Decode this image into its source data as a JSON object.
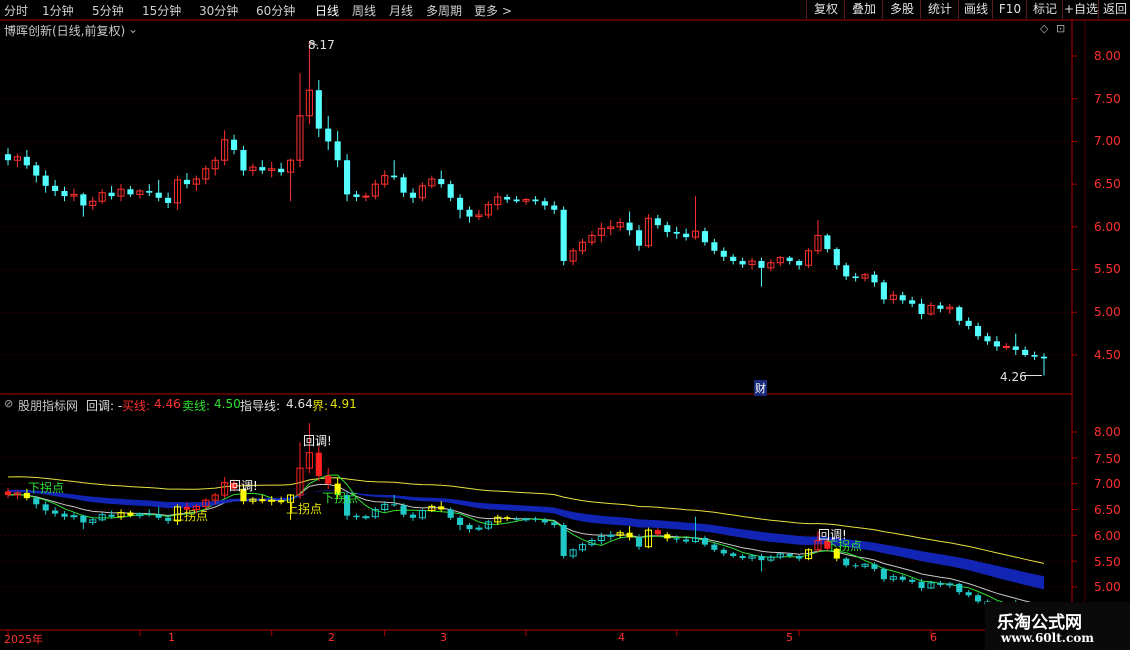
{
  "toolbar": {
    "periods": [
      "分时",
      "1分钟",
      "5分钟",
      "15分钟",
      "30分钟",
      "60分钟",
      "日线",
      "周线",
      "月线",
      "多周期",
      "更多 >"
    ],
    "active_period": "日线",
    "tools": [
      "复权",
      "叠加",
      "多股",
      "统计",
      "画线",
      "F10",
      "标记",
      "+自选",
      "返回"
    ]
  },
  "main_chart": {
    "title": "博晖创新(日线,前复权)",
    "high_label": "8.17",
    "low_label": "4.26",
    "marker": "财",
    "yticks": [
      "8.00",
      "7.50",
      "7.00",
      "6.50",
      "6.00",
      "5.50",
      "5.00",
      "4.50"
    ]
  },
  "indicator": {
    "name": "股朋指标网",
    "back_label": "回调: -",
    "buy_label": "买线:",
    "buy_value": "4.46",
    "sell_label": "卖线:",
    "sell_value": "4.50",
    "guide_label": "指导线:",
    "guide_value": "4.64",
    "bound_label": "界:",
    "bound_value": "4.91",
    "yticks": [
      "8.00",
      "7.50",
      "7.00",
      "6.50",
      "6.00",
      "5.50",
      "5.00"
    ],
    "annotations": {
      "huidiao": "回调!",
      "xia_guai": "下拐点",
      "shang_guai": "上拐点"
    }
  },
  "xaxis": {
    "labels": [
      "2025年",
      "1",
      "2",
      "3",
      "4",
      "5",
      "6"
    ]
  },
  "watermark": {
    "line1": "乐淘公式网",
    "line2": "www.60lt.com"
  },
  "colors": {
    "up": "#ff3030",
    "down": "#54ffff",
    "axis": "#b00000",
    "grid": "#5a0000"
  },
  "chart_data": {
    "type": "candlestick",
    "ylim": [
      4.2,
      8.3
    ],
    "candles": [
      [
        6.85,
        6.92,
        6.72,
        6.78
      ],
      [
        6.78,
        6.86,
        6.7,
        6.82
      ],
      [
        6.82,
        6.9,
        6.68,
        6.72
      ],
      [
        6.72,
        6.76,
        6.52,
        6.6
      ],
      [
        6.6,
        6.66,
        6.4,
        6.48
      ],
      [
        6.48,
        6.55,
        6.36,
        6.42
      ],
      [
        6.42,
        6.47,
        6.3,
        6.36
      ],
      [
        6.36,
        6.45,
        6.3,
        6.38
      ],
      [
        6.38,
        6.4,
        6.12,
        6.25
      ],
      [
        6.25,
        6.35,
        6.2,
        6.3
      ],
      [
        6.3,
        6.44,
        6.27,
        6.4
      ],
      [
        6.4,
        6.48,
        6.32,
        6.36
      ],
      [
        6.36,
        6.5,
        6.3,
        6.44
      ],
      [
        6.44,
        6.48,
        6.35,
        6.38
      ],
      [
        6.38,
        6.44,
        6.33,
        6.42
      ],
      [
        6.42,
        6.5,
        6.36,
        6.4
      ],
      [
        6.4,
        6.55,
        6.3,
        6.34
      ],
      [
        6.34,
        6.4,
        6.22,
        6.28
      ],
      [
        6.28,
        6.6,
        6.2,
        6.55
      ],
      [
        6.55,
        6.63,
        6.45,
        6.5
      ],
      [
        6.5,
        6.6,
        6.42,
        6.56
      ],
      [
        6.56,
        6.72,
        6.5,
        6.68
      ],
      [
        6.68,
        6.82,
        6.6,
        6.78
      ],
      [
        6.78,
        7.13,
        6.72,
        7.02
      ],
      [
        7.02,
        7.08,
        6.85,
        6.9
      ],
      [
        6.9,
        6.95,
        6.6,
        6.66
      ],
      [
        6.66,
        6.74,
        6.6,
        6.7
      ],
      [
        6.7,
        6.78,
        6.62,
        6.66
      ],
      [
        6.66,
        6.76,
        6.58,
        6.68
      ],
      [
        6.68,
        6.75,
        6.6,
        6.64
      ],
      [
        6.64,
        6.8,
        6.3,
        6.78
      ],
      [
        6.78,
        7.8,
        6.7,
        7.3
      ],
      [
        7.3,
        8.17,
        7.2,
        7.6
      ],
      [
        7.6,
        7.72,
        7.05,
        7.15
      ],
      [
        7.15,
        7.3,
        6.9,
        7.0
      ],
      [
        7.0,
        7.12,
        6.7,
        6.78
      ],
      [
        6.78,
        6.85,
        6.3,
        6.38
      ],
      [
        6.38,
        6.42,
        6.3,
        6.35
      ],
      [
        6.35,
        6.4,
        6.3,
        6.36
      ],
      [
        6.36,
        6.55,
        6.32,
        6.5
      ],
      [
        6.5,
        6.66,
        6.46,
        6.6
      ],
      [
        6.6,
        6.78,
        6.55,
        6.58
      ],
      [
        6.58,
        6.62,
        6.35,
        6.4
      ],
      [
        6.4,
        6.45,
        6.28,
        6.34
      ],
      [
        6.34,
        6.52,
        6.3,
        6.48
      ],
      [
        6.48,
        6.6,
        6.45,
        6.56
      ],
      [
        6.56,
        6.66,
        6.46,
        6.5
      ],
      [
        6.5,
        6.54,
        6.3,
        6.34
      ],
      [
        6.34,
        6.38,
        6.1,
        6.2
      ],
      [
        6.2,
        6.24,
        6.05,
        6.12
      ],
      [
        6.12,
        6.2,
        6.08,
        6.14
      ],
      [
        6.14,
        6.3,
        6.1,
        6.26
      ],
      [
        6.26,
        6.4,
        6.2,
        6.35
      ],
      [
        6.35,
        6.38,
        6.28,
        6.32
      ],
      [
        6.32,
        6.36,
        6.28,
        6.3
      ],
      [
        6.3,
        6.34,
        6.26,
        6.32
      ],
      [
        6.32,
        6.36,
        6.26,
        6.3
      ],
      [
        6.3,
        6.34,
        6.2,
        6.25
      ],
      [
        6.25,
        6.3,
        6.15,
        6.2
      ],
      [
        6.2,
        6.24,
        5.55,
        5.6
      ],
      [
        5.6,
        5.75,
        5.55,
        5.72
      ],
      [
        5.72,
        5.86,
        5.68,
        5.82
      ],
      [
        5.82,
        5.95,
        5.78,
        5.9
      ],
      [
        5.9,
        6.05,
        5.82,
        5.98
      ],
      [
        5.98,
        6.08,
        5.9,
        6.0
      ],
      [
        6.0,
        6.1,
        5.95,
        6.05
      ],
      [
        6.05,
        6.18,
        5.9,
        5.96
      ],
      [
        5.96,
        6.02,
        5.72,
        5.78
      ],
      [
        5.78,
        6.15,
        5.75,
        6.1
      ],
      [
        6.1,
        6.14,
        5.98,
        6.02
      ],
      [
        6.02,
        6.06,
        5.88,
        5.94
      ],
      [
        5.94,
        6.0,
        5.86,
        5.92
      ],
      [
        5.92,
        5.98,
        5.84,
        5.88
      ],
      [
        5.88,
        6.36,
        5.85,
        5.95
      ],
      [
        5.95,
        5.99,
        5.78,
        5.82
      ],
      [
        5.82,
        5.86,
        5.68,
        5.72
      ],
      [
        5.72,
        5.76,
        5.6,
        5.65
      ],
      [
        5.65,
        5.68,
        5.56,
        5.6
      ],
      [
        5.6,
        5.64,
        5.52,
        5.56
      ],
      [
        5.56,
        5.64,
        5.5,
        5.6
      ],
      [
        5.6,
        5.64,
        5.3,
        5.52
      ],
      [
        5.52,
        5.62,
        5.48,
        5.58
      ],
      [
        5.58,
        5.66,
        5.54,
        5.64
      ],
      [
        5.64,
        5.66,
        5.56,
        5.6
      ],
      [
        5.6,
        5.62,
        5.5,
        5.55
      ],
      [
        5.55,
        5.75,
        5.52,
        5.72
      ],
      [
        5.72,
        6.08,
        5.68,
        5.9
      ],
      [
        5.9,
        5.92,
        5.7,
        5.74
      ],
      [
        5.74,
        5.76,
        5.5,
        5.55
      ],
      [
        5.55,
        5.58,
        5.38,
        5.42
      ],
      [
        5.42,
        5.46,
        5.36,
        5.4
      ],
      [
        5.4,
        5.46,
        5.36,
        5.44
      ],
      [
        5.44,
        5.48,
        5.3,
        5.35
      ],
      [
        5.35,
        5.38,
        5.1,
        5.15
      ],
      [
        5.15,
        5.25,
        5.1,
        5.2
      ],
      [
        5.2,
        5.24,
        5.1,
        5.14
      ],
      [
        5.14,
        5.18,
        5.06,
        5.1
      ],
      [
        5.1,
        5.16,
        4.92,
        4.98
      ],
      [
        4.98,
        5.12,
        4.96,
        5.08
      ],
      [
        5.08,
        5.12,
        5.0,
        5.04
      ],
      [
        5.04,
        5.1,
        4.98,
        5.06
      ],
      [
        5.06,
        5.08,
        4.85,
        4.9
      ],
      [
        4.9,
        4.94,
        4.8,
        4.84
      ],
      [
        4.84,
        4.88,
        4.68,
        4.72
      ],
      [
        4.72,
        4.76,
        4.62,
        4.66
      ],
      [
        4.66,
        4.72,
        4.55,
        4.6
      ],
      [
        4.6,
        4.64,
        4.56,
        4.6
      ],
      [
        4.6,
        4.75,
        4.5,
        4.56
      ],
      [
        4.56,
        4.6,
        4.48,
        4.5
      ],
      [
        4.5,
        4.54,
        4.44,
        4.48
      ],
      [
        4.48,
        4.52,
        4.26,
        4.46
      ]
    ],
    "xlabel_indices": [
      0,
      14,
      28,
      40,
      55,
      71,
      84,
      98
    ]
  }
}
